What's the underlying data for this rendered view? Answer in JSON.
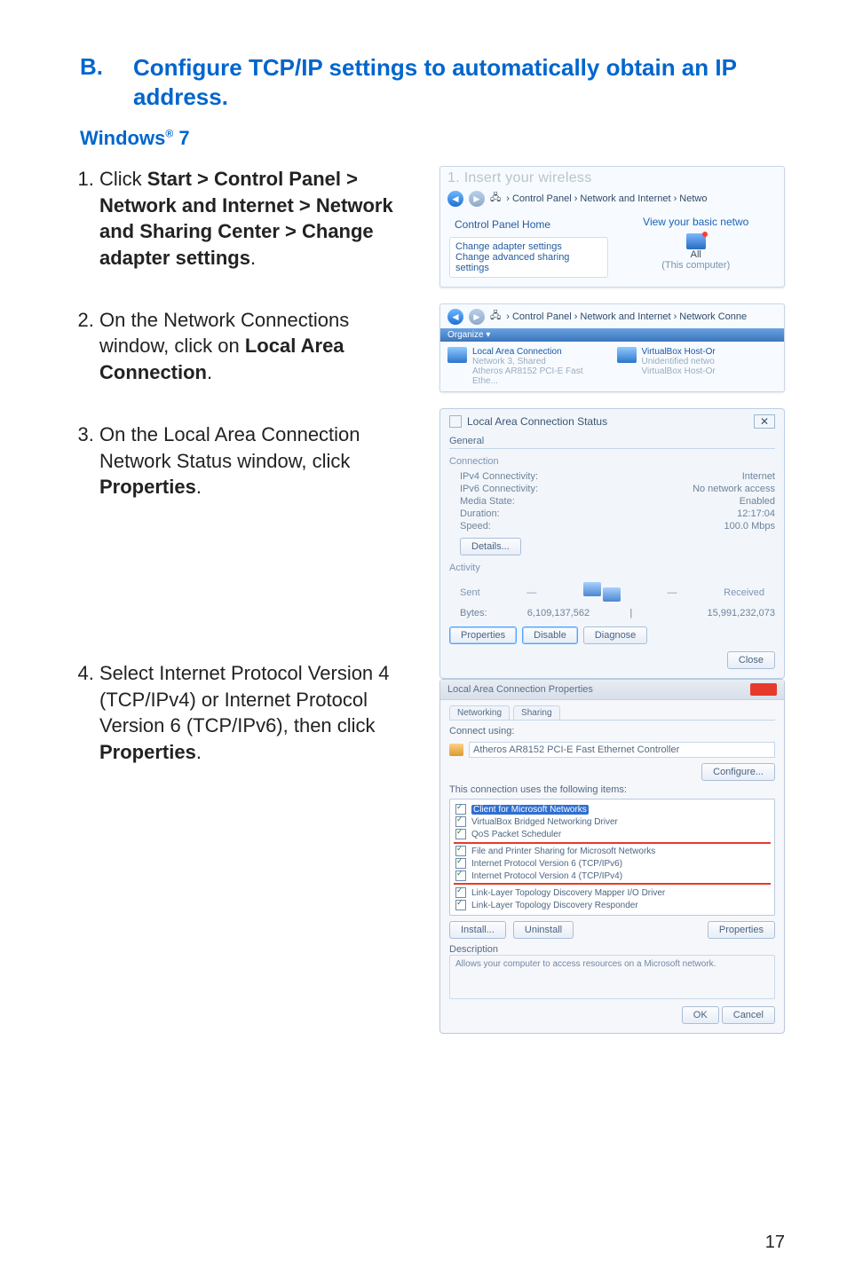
{
  "section": {
    "letter": "B.",
    "title": "Configure TCP/IP settings to automatically obtain an IP address."
  },
  "subheading_prefix": "Windows",
  "subheading_suffix": " 7",
  "steps": [
    {
      "lead": "Click ",
      "bold": "Start > Control Panel > Network and Internet > Network and Sharing Center > Change adapter settings",
      "tail": "."
    },
    {
      "lead": "On the Network Connections window, click on ",
      "bold": "Local Area Connection",
      "tail": "."
    },
    {
      "lead": "On the Local Area Connection Network Status window, click ",
      "bold": "Properties",
      "tail": "."
    },
    {
      "lead": "Select Internet Protocol Version 4 (TCP/IPv4) or Internet Protocol Version 6 (TCP/IPv6), then click ",
      "bold": "Properties",
      "tail": "."
    }
  ],
  "shot1": {
    "blur": "1.  Insert your wireless",
    "crumb": "› Control Panel › Network and Internet › Netwo",
    "cp_home": "Control Panel Home",
    "adapter": "Change adapter settings",
    "advanced": "Change advanced sharing settings",
    "view_link": "View your basic netwo",
    "all": "All",
    "this_pc": "(This computer)"
  },
  "shot2": {
    "crumb": "› Control Panel › Network and Internet › Network Conne",
    "organize": "Organize ▾",
    "lac": "Local Area Connection",
    "net3": "Network 3, Shared",
    "nic": "Atheros AR8152 PCI-E Fast Ethe...",
    "vb": "VirtualBox Host-Or",
    "unid": "Unidentified netwo",
    "vbnic": "VirtualBox Host-Or"
  },
  "status": {
    "title": "Local Area Connection Status",
    "tab": "General",
    "grp_conn": "Connection",
    "kv": [
      {
        "k": "IPv4 Connectivity:",
        "v": "Internet"
      },
      {
        "k": "IPv6 Connectivity:",
        "v": "No network access"
      },
      {
        "k": "Media State:",
        "v": "Enabled"
      },
      {
        "k": "Duration:",
        "v": "12:17:04"
      },
      {
        "k": "Speed:",
        "v": "100.0 Mbps"
      }
    ],
    "details": "Details...",
    "grp_act": "Activity",
    "sent": "Sent",
    "recv": "Received",
    "bytes_lbl": "Bytes:",
    "bytes_sent": "6,109,137,562",
    "bytes_recv": "15,991,232,073",
    "btn_props": "Properties",
    "btn_disable": "Disable",
    "btn_diag": "Diagnose",
    "btn_close": "Close"
  },
  "props": {
    "title": "Local Area Connection Properties",
    "tab1": "Networking",
    "tab2": "Sharing",
    "connect_using": "Connect using:",
    "nic": "Atheros AR8152 PCI-E Fast Ethernet Controller",
    "btn_cfg": "Configure...",
    "list_lbl": "This connection uses the following items:",
    "items": [
      "Client for Microsoft Networks",
      "VirtualBox Bridged Networking Driver",
      "QoS Packet Scheduler",
      "File and Printer Sharing for Microsoft Networks",
      "Internet Protocol Version 6 (TCP/IPv6)",
      "Internet Protocol Version 4 (TCP/IPv4)",
      "Link-Layer Topology Discovery Mapper I/O Driver",
      "Link-Layer Topology Discovery Responder"
    ],
    "btn_install": "Install...",
    "btn_uninstall": "Uninstall",
    "btn_props": "Properties",
    "desc_lbl": "Description",
    "desc": "Allows your computer to access resources on a Microsoft network.",
    "btn_ok": "OK",
    "btn_cancel": "Cancel"
  },
  "page_number": "17"
}
